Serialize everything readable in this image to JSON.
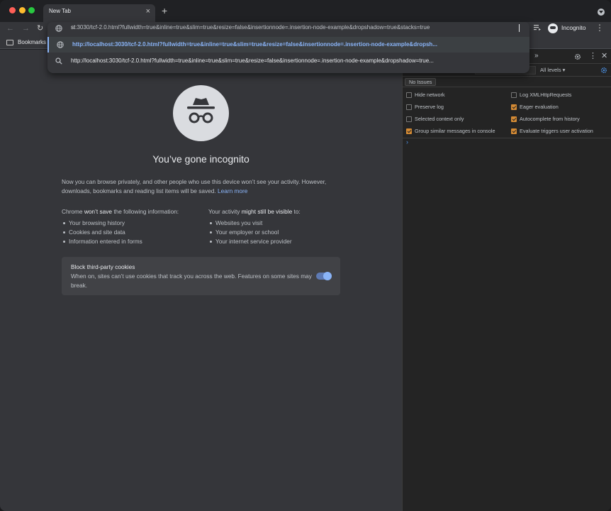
{
  "tab": {
    "title": "New Tab",
    "close": "×",
    "new_tab": "+"
  },
  "toolbar": {
    "back": "←",
    "forward": "→",
    "reload": "↻",
    "address_prefix": "st",
    "address_rest": ":3030/tcf-2.0.html?fullwidth=true&inline=true&slim=true&resize=false&insertionnode=.insertion-node-example&dropshadow=true&stacks=true",
    "suggestions": [
      {
        "icon": "globe-icon",
        "text": "http://localhost:3030/tcf-2.0.html?fullwidth=true&inline=true&slim=true&resize=false&insertionnode=.insertion-node-example&dropsh..."
      },
      {
        "icon": "search-icon",
        "text": "http://localhost:3030/tcf-2.0.html?fullwidth=true&inline=true&slim=true&resize=false&insertionnode=.insertion-node-example&dropshadow=true..."
      }
    ],
    "profile_label": "Incognito",
    "menu": "⋮"
  },
  "bookmarks": {
    "label": "Bookmarks"
  },
  "incognito": {
    "heading": "You’ve gone incognito",
    "intro": "Now you can browse privately, and other people who use this device won’t see your activity. However, downloads, bookmarks and reading list items will be saved.",
    "learn_more": "Learn more",
    "col1_lead": "Chrome ",
    "col1_bold": "won’t save",
    "col1_tail": " the following information:",
    "col1_items": [
      "Your browsing history",
      "Cookies and site data",
      "Information entered in forms"
    ],
    "col2_lead": "Your activity ",
    "col2_bold": "might still be visible",
    "col2_tail": " to:",
    "col2_items": [
      "Websites you visit",
      "Your employer or school",
      "Your internet service provider"
    ],
    "cookie_title": "Block third-party cookies",
    "cookie_desc": "When on, sites can’t use cookies that track you across the web. Features on some sites may break.",
    "cookie_toggle_on": true
  },
  "devtools": {
    "more_tabs": "»",
    "dots": "⋮",
    "close": "✕",
    "levels": "All levels ▾",
    "issues": "No Issues",
    "options_left": [
      {
        "label": "Hide network",
        "checked": false
      },
      {
        "label": "Preserve log",
        "checked": false
      },
      {
        "label": "Selected context only",
        "checked": false
      },
      {
        "label": "Group similar messages in console",
        "checked": true
      }
    ],
    "options_right": [
      {
        "label": "Log XMLHttpRequests",
        "checked": false
      },
      {
        "label": "Eager evaluation",
        "checked": true
      },
      {
        "label": "Autocomplete from history",
        "checked": true
      },
      {
        "label": "Evaluate triggers user activation",
        "checked": true
      }
    ],
    "prompt": "›"
  },
  "colors": {
    "accent_blue": "#8ab4f8",
    "checkbox_orange": "#d38a34",
    "page_bg": "#35363a"
  }
}
